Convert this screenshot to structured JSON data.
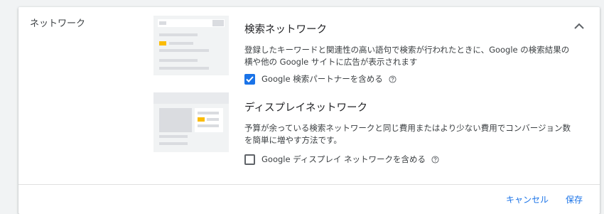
{
  "section": {
    "label": "ネットワーク"
  },
  "search_network": {
    "title": "検索ネットワーク",
    "description": "登録したキーワードと関連性の高い語句で検索が行われたときに、Google の検索結果の横や他の Google サイトに広告が表示されます",
    "checkbox_label": "Google 検索パートナーを含める",
    "checked": true
  },
  "display_network": {
    "title": "ディスプレイネットワーク",
    "description": "予算が余っている検索ネットワークと同じ費用またはより少ない費用でコンバージョン数を簡単に増やす方法です。",
    "checkbox_label": "Google ディスプレイ ネットワークを含める",
    "checked": false
  },
  "footer": {
    "cancel_label": "キャンセル",
    "save_label": "保存"
  },
  "colors": {
    "accent": "#1a73e8",
    "illustration_yellow": "#fbbc04",
    "illustration_gray": "#dadce0"
  }
}
